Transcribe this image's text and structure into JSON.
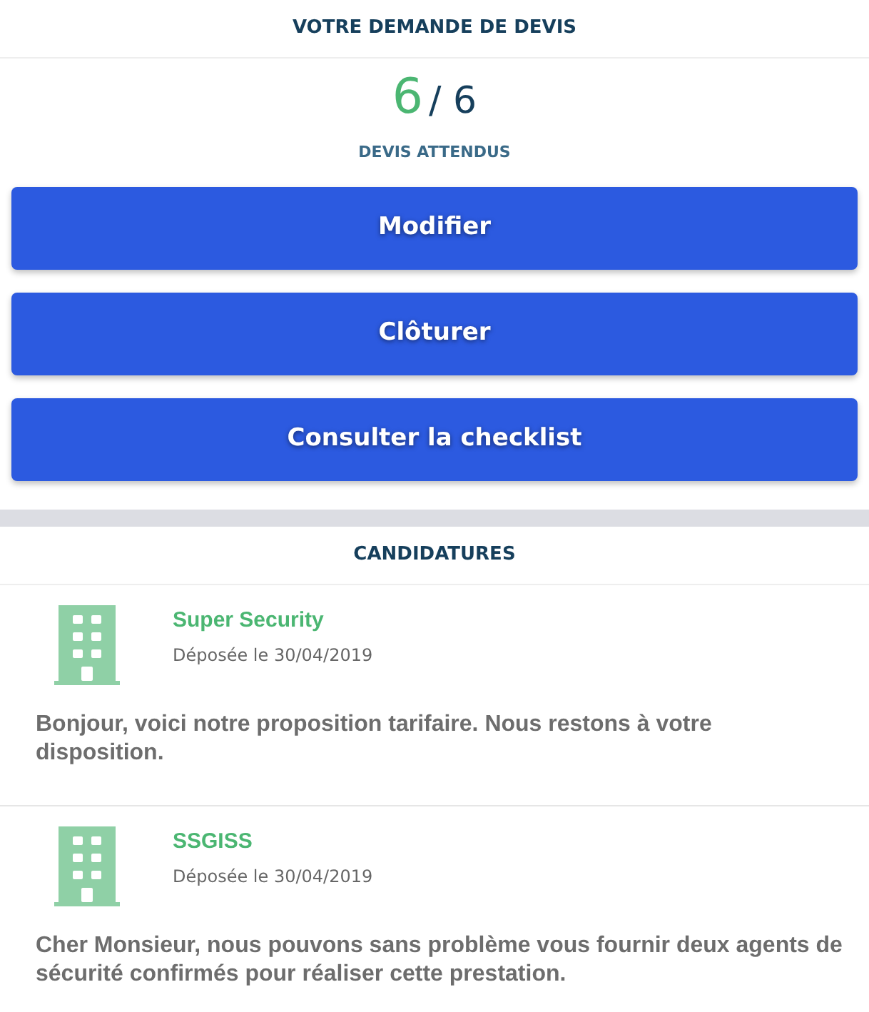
{
  "request": {
    "title": "VOTRE DEMANDE DE DEVIS",
    "received": "6",
    "total": "/ 6",
    "caption": "DEVIS ATTENDUS",
    "buttons": [
      "Modifier",
      "Clôturer",
      "Consulter la checklist"
    ]
  },
  "applications": {
    "title": "CANDIDATURES",
    "items": [
      {
        "company": "Super Security",
        "date": "Déposée le 30/04/2019",
        "message": "Bonjour, voici notre proposition tarifaire. Nous restons à votre disposition."
      },
      {
        "company": "SSGISS",
        "date": "Déposée le 30/04/2019",
        "message": "Cher Monsieur, nous pouvons sans problème vous fournir deux agents de sécurité confirmés pour réaliser cette prestation."
      }
    ]
  }
}
